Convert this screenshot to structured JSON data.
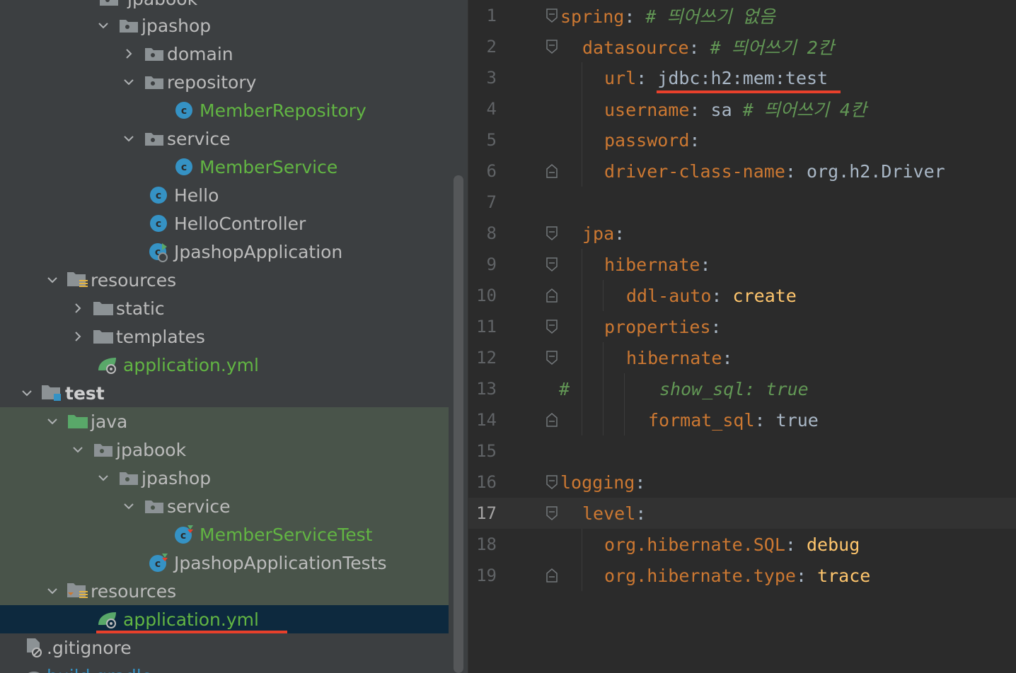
{
  "tree": {
    "rows": [
      {
        "label": "jpabook"
      },
      {
        "label": "jpashop"
      },
      {
        "label": "domain"
      },
      {
        "label": "repository"
      },
      {
        "label": "MemberRepository"
      },
      {
        "label": "service"
      },
      {
        "label": "MemberService"
      },
      {
        "label": "Hello"
      },
      {
        "label": "HelloController"
      },
      {
        "label": "JpashopApplication"
      },
      {
        "label": "resources"
      },
      {
        "label": "static"
      },
      {
        "label": "templates"
      },
      {
        "label": "application.yml"
      },
      {
        "label": "test"
      },
      {
        "label": "java"
      },
      {
        "label": "jpabook"
      },
      {
        "label": "jpashop"
      },
      {
        "label": "service"
      },
      {
        "label": "MemberServiceTest"
      },
      {
        "label": "JpashopApplicationTests"
      },
      {
        "label": "resources"
      },
      {
        "label": "application.yml"
      },
      {
        "label": ".gitignore"
      },
      {
        "label": "build.gradle"
      }
    ]
  },
  "editor": {
    "current_line": 17,
    "lines": [
      {
        "num": "1",
        "key": "spring",
        "colon": ":",
        "rest": " # 띄어쓰기 없음"
      },
      {
        "num": "2",
        "key": "datasource",
        "colon": ":",
        "rest": " # 띄어쓰기 2칸"
      },
      {
        "num": "3",
        "key": "url",
        "colon": ":",
        "value": "jdbc:h2:mem:test"
      },
      {
        "num": "4",
        "key": "username",
        "colon": ":",
        "value": "sa",
        "comment": "# 띄어쓰기 4칸"
      },
      {
        "num": "5",
        "key": "password",
        "colon": ":"
      },
      {
        "num": "6",
        "key": "driver-class-name",
        "colon": ":",
        "value": "org.h2.Driver"
      },
      {
        "num": "7"
      },
      {
        "num": "8",
        "key": "jpa",
        "colon": ":"
      },
      {
        "num": "9",
        "key": "hibernate",
        "colon": ":"
      },
      {
        "num": "10",
        "key": "ddl-auto",
        "colon": ":",
        "value": "create"
      },
      {
        "num": "11",
        "key": "properties",
        "colon": ":"
      },
      {
        "num": "12",
        "key": "hibernate",
        "colon": ":"
      },
      {
        "num": "13",
        "hash": "#",
        "comment": "show_sql: true"
      },
      {
        "num": "14",
        "key": "format_sql",
        "colon": ":",
        "value": "true"
      },
      {
        "num": "15"
      },
      {
        "num": "16",
        "key": "logging",
        "colon": ":"
      },
      {
        "num": "17",
        "key": "level",
        "colon": ":"
      },
      {
        "num": "18",
        "key": "org.hibernate.SQL",
        "colon": ":",
        "value": "debug"
      },
      {
        "num": "19",
        "key": "org.hibernate.type",
        "colon": ":",
        "value": "trace"
      }
    ]
  },
  "colors": {
    "tree_bg": "#3c3f41",
    "editor_bg": "#2b2b2b",
    "yaml_key": "#cc7832",
    "comment": "#629755",
    "highlight_underline": "#e8402b",
    "selection": "#0d293e"
  }
}
